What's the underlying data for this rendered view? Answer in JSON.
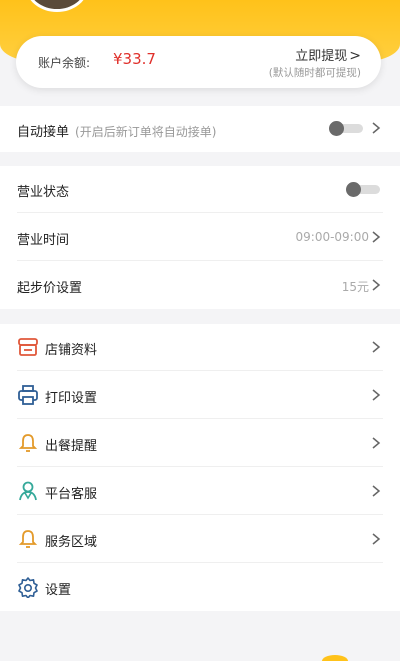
{
  "balance": {
    "label": "账户余额:",
    "value": "¥33.7",
    "withdraw_title": "立即提现",
    "withdraw_sub": "(默认随时都可提现)"
  },
  "auto_accept": {
    "label": "自动接单",
    "hint": "(开启后新订单将自动接单)"
  },
  "business": {
    "status_label": "营业状态",
    "hours_label": "营业时间",
    "hours_value": "09:00-09:00",
    "min_price_label": "起步价设置",
    "min_price_value": "15元"
  },
  "menu": {
    "items": [
      {
        "label": "店铺资料",
        "icon": "store-icon"
      },
      {
        "label": "打印设置",
        "icon": "printer-icon"
      },
      {
        "label": "出餐提醒",
        "icon": "bell-icon"
      },
      {
        "label": "平台客服",
        "icon": "customer-service-icon"
      },
      {
        "label": "服务区域",
        "icon": "bell-icon"
      },
      {
        "label": "设置",
        "icon": "gear-icon"
      }
    ]
  },
  "colors": {
    "accent": "#ffc21a",
    "price": "#e0302b",
    "icon_blue": "#2f5f96",
    "icon_orange": "#e39a2a",
    "icon_teal": "#35a99a"
  }
}
